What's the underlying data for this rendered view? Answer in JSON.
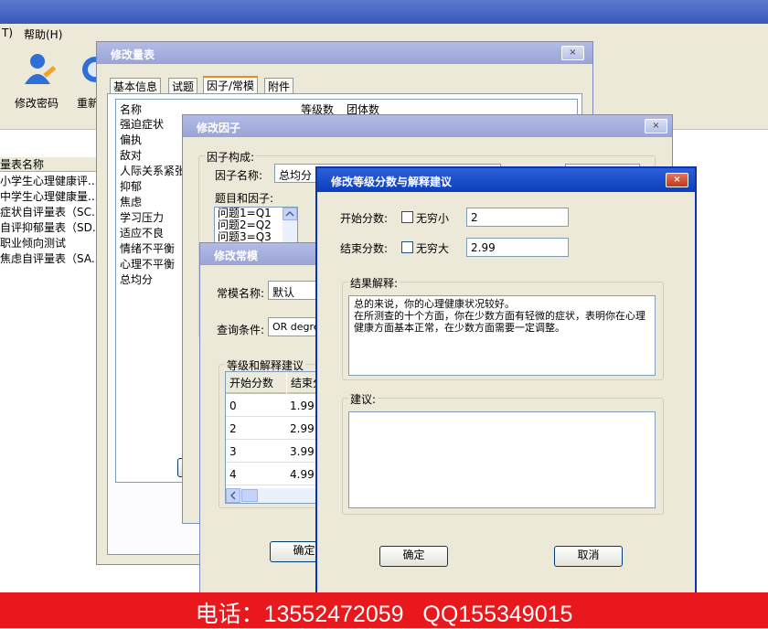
{
  "app": {
    "menu": [
      "T)",
      "帮助(H)"
    ],
    "toolbar": [
      {
        "label": "修改密码",
        "icon": "user-edit-icon"
      },
      {
        "label": "重新",
        "icon": "refresh-icon"
      }
    ],
    "list_header": "量表名称",
    "list_items": [
      "小学生心理健康评...",
      "中学生心理健康量...",
      "症状自评量表（SC...",
      "自评抑郁量表（SD...",
      "职业倾向测试",
      "焦虑自评量表（SA..."
    ]
  },
  "win_scale": {
    "title": "修改量表",
    "close": "×",
    "tabs": [
      "基本信息",
      "试题",
      "因子/常模",
      "附件"
    ],
    "columns": [
      "名称",
      "等级数",
      "团体数"
    ],
    "rows": [
      "强迫症状",
      "偏执",
      "敌对",
      "人际关系紧张",
      "抑郁",
      "焦虑",
      "学习压力",
      "适应不良",
      "情绪不平衡",
      "心理不平衡",
      "总均分"
    ]
  },
  "win_factor": {
    "title": "修改因子",
    "close": "×",
    "group_label": "因子构成:",
    "name_label": "因子名称:",
    "name_value": "总均分",
    "items_label": "题目和因子:",
    "items": [
      "问题1=Q1",
      "问题2=Q2",
      "问题3=Q3"
    ]
  },
  "win_norm": {
    "title": "修改常模",
    "name_label": "常模名称:",
    "name_value": "默认",
    "cond_label": "查询条件:",
    "cond_value": "OR degre",
    "group_label": "等级和解释建议",
    "columns": [
      "开始分数",
      "结束分"
    ],
    "rows": [
      [
        "0",
        "1.99"
      ],
      [
        "2",
        "2.99"
      ],
      [
        "3",
        "3.99"
      ],
      [
        "4",
        "4.99"
      ]
    ],
    "ok": "确定"
  },
  "win_grade": {
    "title": "修改等级分数与解释建议",
    "close": "×",
    "start_label": "开始分数:",
    "start_inf": "无穷小",
    "start_value": "2",
    "end_label": "结束分数:",
    "end_inf": "无穷大",
    "end_value": "2.99",
    "result_label": "结果解释:",
    "result_text": "总的来说，你的心理健康状况较好。\n在所测查的十个方面，你在少数方面有轻微的症状，表明你在心理健康方面基本正常，在少数方面需要一定调整。",
    "advice_label": "建议:",
    "advice_text": "",
    "ok": "确定",
    "cancel": "取消"
  },
  "banner": {
    "text": "电话：13552472059   QQ155349015",
    "bg": "#e8181c"
  }
}
